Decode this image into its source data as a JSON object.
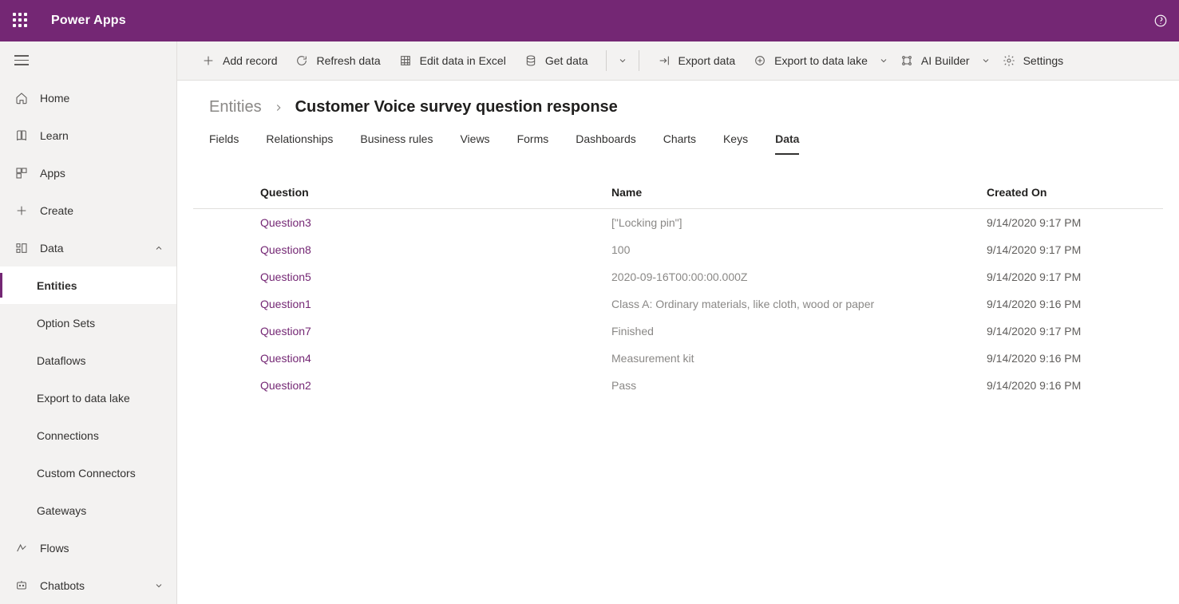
{
  "app_title": "Power Apps",
  "nav": {
    "home": "Home",
    "learn": "Learn",
    "apps": "Apps",
    "create": "Create",
    "data": "Data",
    "entities": "Entities",
    "option_sets": "Option Sets",
    "dataflows": "Dataflows",
    "export_lake": "Export to data lake",
    "connections": "Connections",
    "custom_connectors": "Custom Connectors",
    "gateways": "Gateways",
    "flows": "Flows",
    "chatbots": "Chatbots"
  },
  "toolbar": {
    "add_record": "Add record",
    "refresh_data": "Refresh data",
    "edit_excel": "Edit data in Excel",
    "get_data": "Get data",
    "export_data": "Export data",
    "export_lake": "Export to data lake",
    "ai_builder": "AI Builder",
    "settings": "Settings"
  },
  "breadcrumb": {
    "root": "Entities",
    "leaf": "Customer Voice survey question response"
  },
  "tabs": {
    "fields": "Fields",
    "relationships": "Relationships",
    "business_rules": "Business rules",
    "views": "Views",
    "forms": "Forms",
    "dashboards": "Dashboards",
    "charts": "Charts",
    "keys": "Keys",
    "data": "Data"
  },
  "table": {
    "headers": {
      "question": "Question",
      "name": "Name",
      "created_on": "Created On"
    },
    "rows": [
      {
        "question": "Question3",
        "name": "[\"Locking pin\"]",
        "created_on": "9/14/2020 9:17 PM"
      },
      {
        "question": "Question8",
        "name": "100",
        "created_on": "9/14/2020 9:17 PM"
      },
      {
        "question": "Question5",
        "name": "2020-09-16T00:00:00.000Z",
        "created_on": "9/14/2020 9:17 PM"
      },
      {
        "question": "Question1",
        "name": "Class A: Ordinary materials, like cloth, wood or paper",
        "created_on": "9/14/2020 9:16 PM"
      },
      {
        "question": "Question7",
        "name": "Finished",
        "created_on": "9/14/2020 9:17 PM"
      },
      {
        "question": "Question4",
        "name": "Measurement kit",
        "created_on": "9/14/2020 9:16 PM"
      },
      {
        "question": "Question2",
        "name": "Pass",
        "created_on": "9/14/2020 9:16 PM"
      }
    ]
  }
}
